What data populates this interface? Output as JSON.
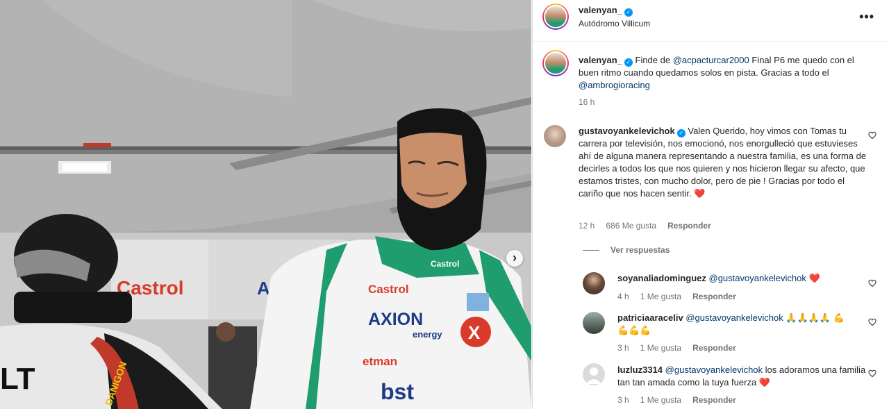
{
  "post": {
    "username": "valenyan_",
    "location": "Autódromo Villicum",
    "caption": {
      "text_1": "Finde de ",
      "mention_1": "@acpacturcar2000",
      "text_2": " Final P6 me quedo con el buen ritmo cuando quedamos solos en pista. Gracias a todo el ",
      "mention_2": "@ambrogioracing",
      "time": "16 h"
    }
  },
  "comments": [
    {
      "username": "gustavoyankelevichok",
      "text": "Valen Querido, hoy vimos con Tomas tu carrera por televisión, nos emocionó, nos enorgulleció que estuvieses ahí de alguna manera representando a nuestra familia, es una forma de decirles a todos los que nos quieren y nos hicieron llegar su afecto, que estamos tristes, con mucho dolor, pero de pie ! Gracias por todo el cariño que nos hacen sentir.",
      "emoji": "❤️",
      "time": "12 h",
      "likes": "686 Me gusta",
      "reply": "Responder",
      "view_replies": "Ver respuestas"
    },
    {
      "username": "soyanaliadominguez",
      "mention": "@gustavoyankelevichok",
      "text": "",
      "emoji": "❤️",
      "time": "4 h",
      "likes": "1 Me gusta",
      "reply": "Responder"
    },
    {
      "username": "patriciaaraceliv",
      "mention": "@gustavoyankelevichok",
      "text": "",
      "emoji": "🙏🙏🙏🙏 💪💪💪💪",
      "time": "3 h",
      "likes": "1 Me gusta",
      "reply": "Responder"
    },
    {
      "username": "luzluz3314",
      "mention": "@gustavoyankelevichok",
      "text": " los adoramos una familia tan tan amada como la tuya fuerza ",
      "emoji": "❤️",
      "time": "3 h",
      "likes": "1 Me gusta",
      "reply": "Responder"
    }
  ],
  "photo": {
    "suit_sponsor_1": "Castrol",
    "suit_sponsor_2": "AXION",
    "suit_sponsor_2b": "energy",
    "suit_sponsor_3": "etman",
    "suit_sponsor_4": "bst",
    "banner_1": "Castrol",
    "banner_2": "AXI",
    "car_text": "DANIGON",
    "car_text_2": "LT"
  },
  "colors": {
    "accent": "#0095f6",
    "link": "#00376b",
    "heart": "#ed4956",
    "suit_green": "#1f9d6e"
  }
}
